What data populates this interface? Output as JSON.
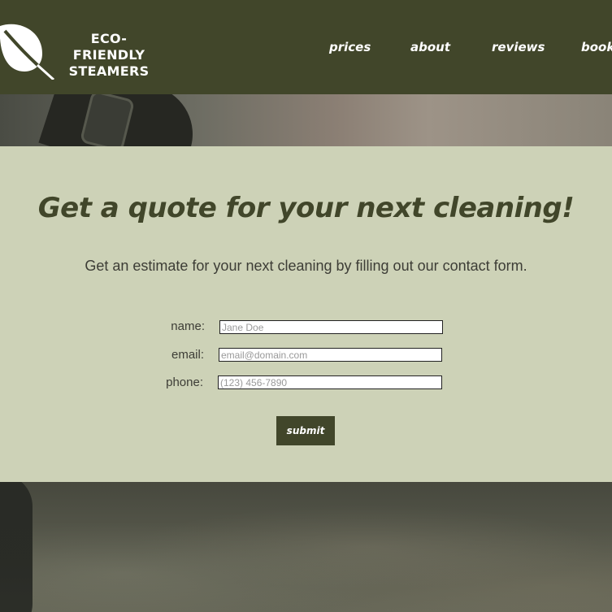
{
  "brand": {
    "line1": "ECO-FRIENDLY",
    "line2": "STEAMERS",
    "logo_icon": "leaf-icon"
  },
  "nav": {
    "items": [
      {
        "label": "prices"
      },
      {
        "label": "about"
      },
      {
        "label": "reviews"
      },
      {
        "label": "book"
      }
    ]
  },
  "quote": {
    "title": "Get a quote for your next cleaning!",
    "subtitle": "Get an estimate for your next cleaning by filling out our contact form.",
    "form": {
      "name": {
        "label": "name:",
        "placeholder": "Jane Doe",
        "value": ""
      },
      "email": {
        "label": "email:",
        "placeholder": "email@domain.com",
        "value": ""
      },
      "phone": {
        "label": "phone:",
        "placeholder": "(123) 456-7890",
        "value": ""
      },
      "submit_label": "submit"
    }
  },
  "colors": {
    "header_bg": "#41462a",
    "section_bg": "#cdd2b7",
    "accent": "#41462a"
  }
}
